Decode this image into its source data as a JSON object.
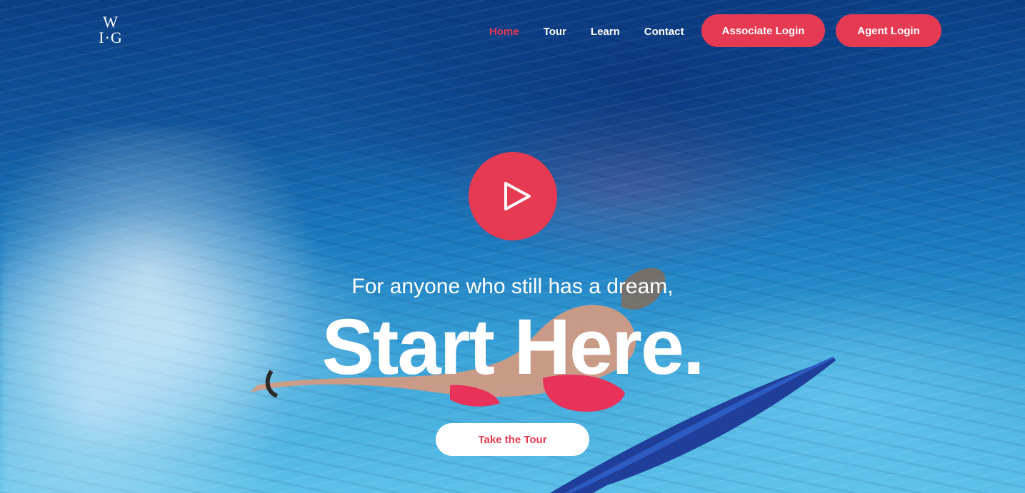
{
  "brand": {
    "logo_line1": "W",
    "logo_line2": "I·G"
  },
  "nav": {
    "items": [
      {
        "label": "Home",
        "active": true
      },
      {
        "label": "Tour",
        "active": false
      },
      {
        "label": "Learn",
        "active": false
      },
      {
        "label": "Contact",
        "active": false
      }
    ],
    "associate_login": "Associate Login",
    "agent_login": "Agent Login"
  },
  "hero": {
    "play_icon": "play-icon",
    "tagline": "For anyone who still has a dream,",
    "headline": "Start Here.",
    "cta": "Take the Tour",
    "background": "underwater-surfer-photo"
  },
  "colors": {
    "accent": "#e63a52",
    "text": "#ffffff",
    "cta_background": "#ffffff"
  }
}
